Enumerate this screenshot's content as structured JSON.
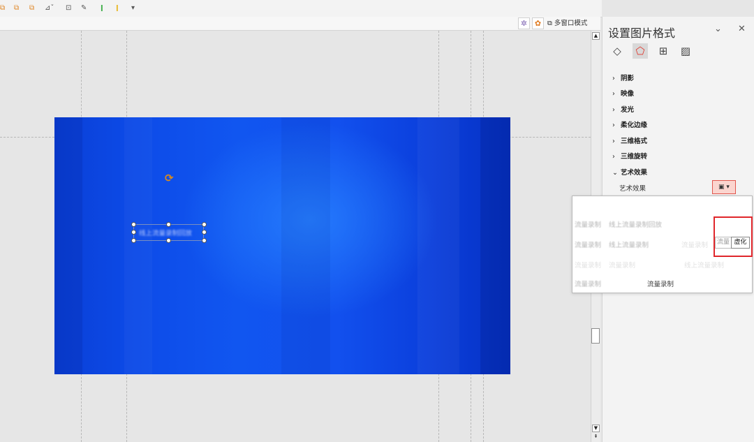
{
  "window": {
    "multi_window_label": "多窗口模式"
  },
  "panel": {
    "title": "设置图片格式",
    "collapse_icon": "chevron-down-icon",
    "close_icon": "close-icon",
    "tabs": [
      {
        "icon": "fill-bucket-icon"
      },
      {
        "icon": "pentagon-effects-icon"
      },
      {
        "icon": "size-position-icon"
      },
      {
        "icon": "picture-icon"
      }
    ],
    "sections": [
      {
        "label": "阴影",
        "expanded": false
      },
      {
        "label": "映像",
        "expanded": false
      },
      {
        "label": "发光",
        "expanded": false
      },
      {
        "label": "柔化边缘",
        "expanded": false
      },
      {
        "label": "三维格式",
        "expanded": false
      },
      {
        "label": "三维旋转",
        "expanded": false
      },
      {
        "label": "艺术效果",
        "expanded": true
      }
    ],
    "art_effects_label": "艺术效果"
  },
  "popup": {
    "row1": {
      "left": "流量录制",
      "mid": "线上流量录制回放"
    },
    "row2": {
      "left": "流量录制",
      "mid": "线上流量录制",
      "right": "流量录制"
    },
    "row3": {
      "left": "流量录制",
      "mid": "流量录制",
      "right": "线上流量录制"
    },
    "row4": {
      "left": "流量录制",
      "right": "流量录制"
    },
    "tooltip_left": "流量",
    "tooltip_label": "虚化"
  },
  "slide": {
    "textbox_text": "线上流量录制回放"
  }
}
